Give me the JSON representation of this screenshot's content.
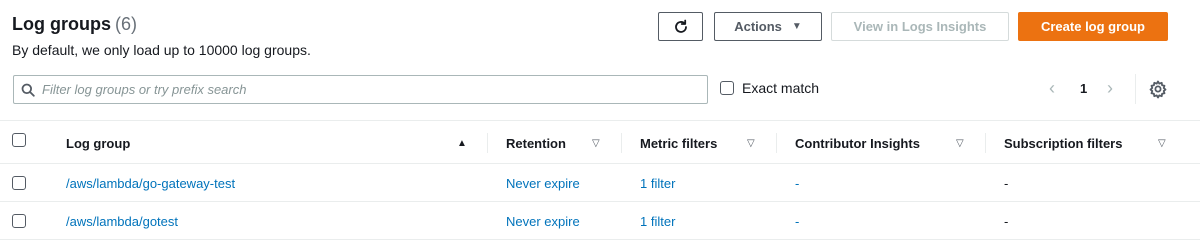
{
  "header": {
    "title": "Log groups",
    "count": "(6)",
    "subtitle": "By default, we only load up to 10000 log groups."
  },
  "toolbar": {
    "refresh_icon": "refresh-icon",
    "actions_label": "Actions",
    "view_insights_label": "View in Logs Insights",
    "create_label": "Create log group",
    "accent_color": "#ec7211"
  },
  "filter": {
    "placeholder": "Filter log groups or try prefix search",
    "value": "",
    "exact_match_label": "Exact match"
  },
  "pagination": {
    "page": "1"
  },
  "table": {
    "columns": [
      {
        "label": "Log group"
      },
      {
        "label": "Retention"
      },
      {
        "label": "Metric filters"
      },
      {
        "label": "Contributor Insights"
      },
      {
        "label": "Subscription filters"
      }
    ],
    "rows": [
      {
        "log_group": "/aws/lambda/go-gateway-test",
        "retention": "Never expire",
        "metric_filters": "1 filter",
        "contributor_insights": "-",
        "subscription_filters": "-"
      },
      {
        "log_group": "/aws/lambda/gotest",
        "retention": "Never expire",
        "metric_filters": "1 filter",
        "contributor_insights": "-",
        "subscription_filters": "-"
      }
    ]
  }
}
